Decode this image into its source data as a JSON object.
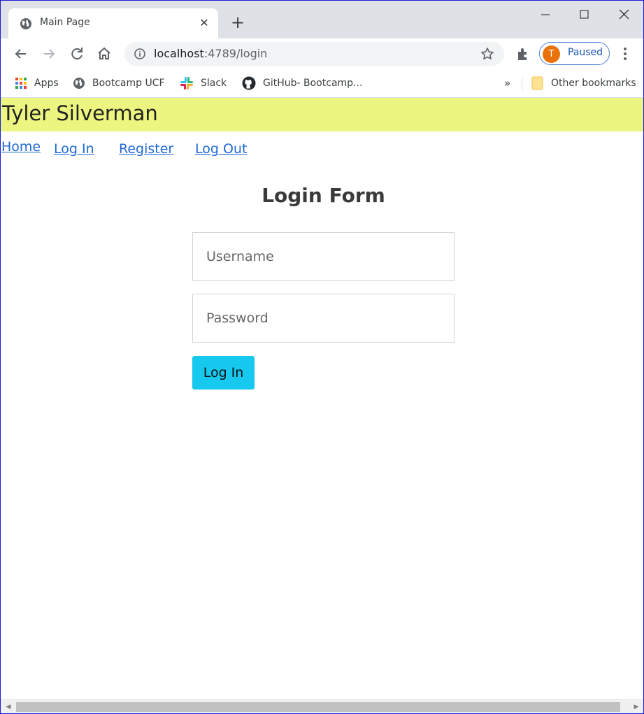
{
  "browser": {
    "tab_title": "Main Page",
    "url_host": "localhost",
    "url_rest": ":4789/login",
    "profile_initial": "T",
    "profile_status": "Paused",
    "bookmarks": [
      "Apps",
      "Bootcamp UCF",
      "Slack",
      "GitHub- Bootcamp..."
    ],
    "bookmarks_more": "»",
    "other_bookmarks": "Other bookmarks"
  },
  "site": {
    "title": "Tyler Silverman",
    "nav": {
      "home": "Home",
      "login": "Log In",
      "register": "Register",
      "logout": "Log Out"
    }
  },
  "form": {
    "title": "Login Form",
    "username_placeholder": "Username",
    "password_placeholder": "Password",
    "submit_label": "Log In"
  },
  "colors": {
    "header_bg": "#ecf57f",
    "link": "#2169d6",
    "button_bg": "#17c8ef",
    "profile_avatar": "#e8710a"
  }
}
